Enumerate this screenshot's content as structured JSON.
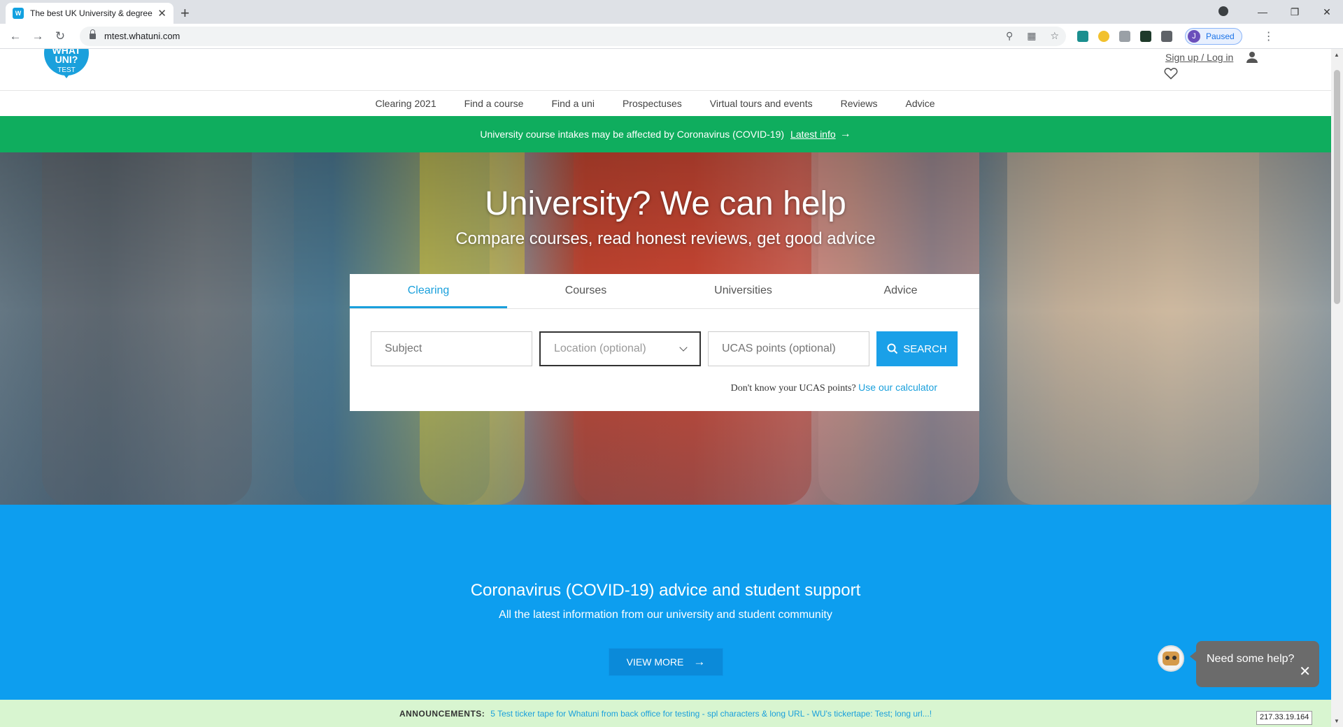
{
  "browser": {
    "tab_title": "The best UK University & degree",
    "url": "mtest.whatuni.com",
    "profile_initial": "J",
    "profile_status": "Paused"
  },
  "header": {
    "logo_line1": "WHAT",
    "logo_line2": "UNI?",
    "logo_line3": "TEST",
    "signup_label": "Sign up / Log in"
  },
  "nav": {
    "items": [
      "Clearing 2021",
      "Find a course",
      "Find a uni",
      "Prospectuses",
      "Virtual tours and events",
      "Reviews",
      "Advice"
    ]
  },
  "covid_bar": {
    "text": "University course intakes may be affected by Coronavirus (COVID-19)",
    "link": "Latest info"
  },
  "hero": {
    "title": "University? We can help",
    "subtitle": "Compare courses, read honest reviews, get good advice"
  },
  "search": {
    "tabs": [
      "Clearing",
      "Courses",
      "Universities",
      "Advice"
    ],
    "active_tab": "Clearing",
    "subject_placeholder": "Subject",
    "location_placeholder": "Location (optional)",
    "ucas_placeholder": "UCAS points (optional)",
    "button_label": "SEARCH",
    "ucas_question": "Don't know your UCAS points?",
    "ucas_link": "Use our calculator"
  },
  "covid_section": {
    "title": "Coronavirus (COVID-19) advice and student support",
    "subtitle": "All the latest information from our university and student community",
    "button_label": "VIEW MORE"
  },
  "announcement": {
    "label": "ANNOUNCEMENTS:",
    "message": "5 Test ticker tape for Whatuni from back office for testing - spl characters & long URL - WU's tickertape: Test; long url...!"
  },
  "chat": {
    "help_text": "Need some help?"
  },
  "status": {
    "ip": "217.33.19.164"
  },
  "colors": {
    "brand_blue": "#1aa0dc",
    "covid_green": "#0fad5e",
    "section_blue": "#0d9eef",
    "announce_bg": "#d8f5d0"
  }
}
